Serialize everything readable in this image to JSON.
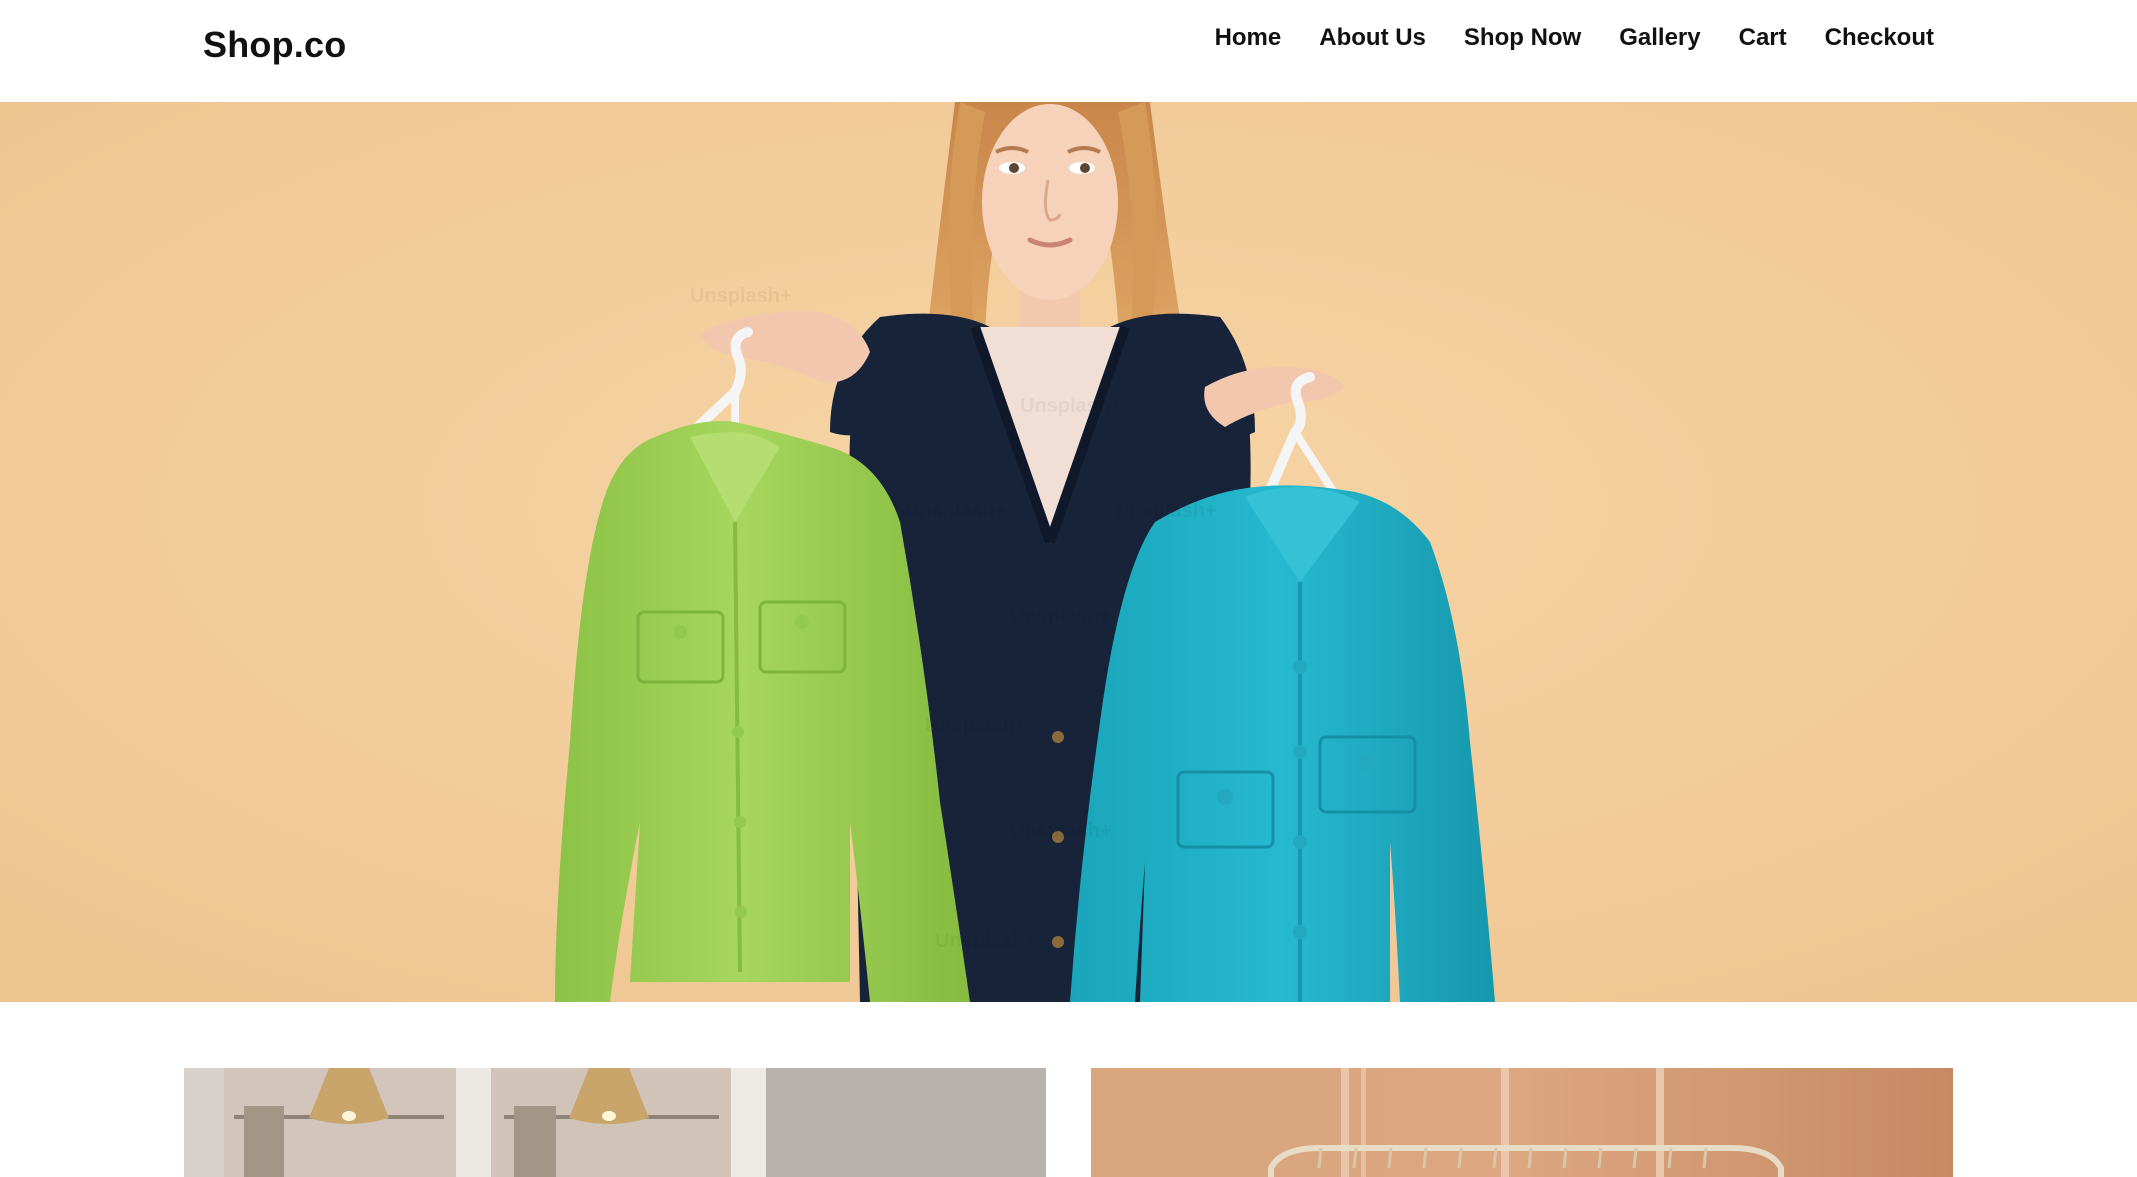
{
  "header": {
    "logo": "Shop.co",
    "nav": [
      {
        "label": "Home"
      },
      {
        "label": "About Us"
      },
      {
        "label": "Shop Now"
      },
      {
        "label": "Gallery"
      },
      {
        "label": "Cart"
      },
      {
        "label": "Checkout"
      }
    ]
  },
  "hero": {
    "image_subject": "woman holding a green shirt and a teal shirt on hangers",
    "watermark": "Unsplash+"
  },
  "cards": [
    {
      "image_subject": "boutique clothing racks with wicker pendant lamps"
    },
    {
      "image_subject": "clothing rack against peach wall"
    }
  ],
  "colors": {
    "hero_bg": "#f4cf9f",
    "green_shirt": "#9fcf55",
    "teal_shirt": "#1fb0c6",
    "cardigan": "#152238",
    "nav_text": "#111111"
  }
}
